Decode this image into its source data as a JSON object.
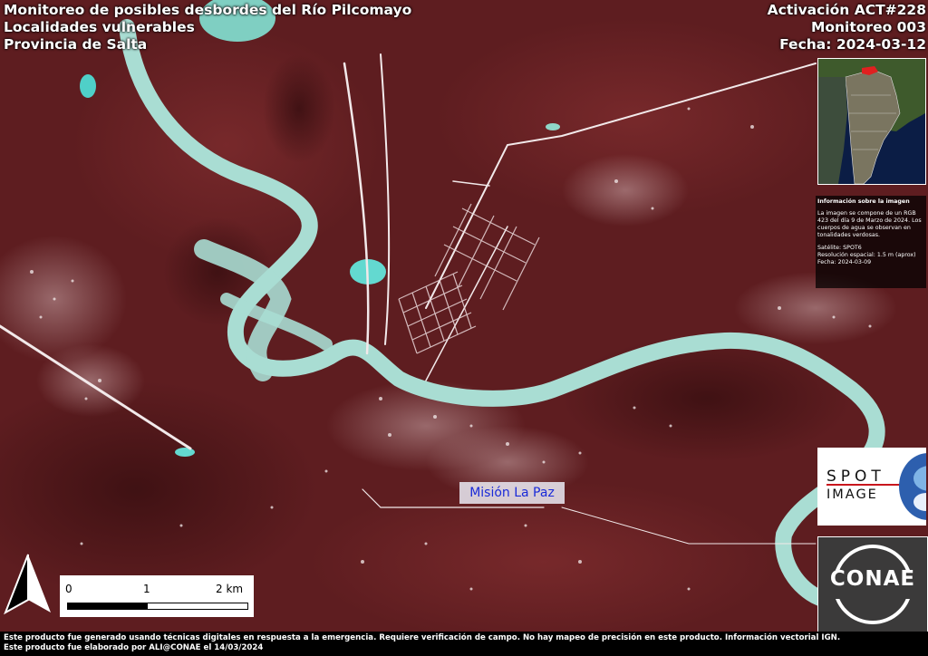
{
  "title": {
    "line1": "Monitoreo de posibles desbordes del Río Pilcomayo",
    "line2": "Localidades vulnerables",
    "line3": "Provincia de Salta"
  },
  "activation": {
    "code": "Activación ACT#228",
    "monitoring": "Monitoreo 003",
    "date": "Fecha: 2024-03-12"
  },
  "image_info": {
    "header": "Información sobre la imagen",
    "description": "La imagen se compone de un RGB 423  del día 9 de Marzo de 2024. Los cuerpos de agua se observan en tonalidades verdosas.",
    "satellite": "Satélite: SPOT6",
    "resolution": "Resolución espacial: 1.5 m (aprox)",
    "date": "Fecha: 2024-03-09"
  },
  "place_label": "Misión La Paz",
  "scale": {
    "label_0": "0",
    "label_1": "1",
    "label_2": "2 km"
  },
  "logos": {
    "spot_line1": "SPOT",
    "spot_line2": "IMAGE",
    "conae": "CONAE"
  },
  "footer": {
    "line1": "Este producto fue generado usando técnicas digitales en respuesta a la emergencia. Requiere verificación de campo. No hay mapeo de precisión en este producto. Información vectorial IGN.",
    "line2": "Este producto fue elaborado por ALI@CONAE el 14/03/2024"
  },
  "colors": {
    "terrain": "#5a1c1e",
    "water": "#a9ddd3",
    "roads": "#f2e9ea",
    "label_text": "#1a2ad8"
  }
}
